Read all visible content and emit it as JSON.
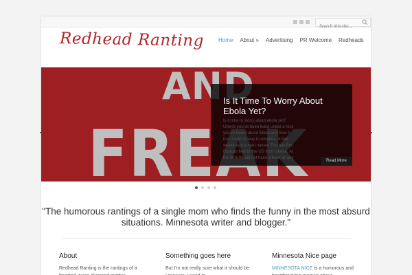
{
  "header": {
    "search_placeholder": "Search this site...",
    "logo_text": "Redhead Ranting",
    "nav": [
      "Home",
      "About »",
      "Advertising",
      "PR Welcome",
      "Redheads"
    ]
  },
  "hero": {
    "bg_word_1": "AND",
    "bg_word_2": "FREAK",
    "title": "Is It Time To Worry About Ebola Yet?",
    "excerpt": "Is it time to worry about ebola yet? Unless you've been living under a rock you've heard about Ebola and how it has made its way to America. A few weeks ago a man named Thomas Eric Duncan flew to the US from Liberia. At the time he did not have a fever or any",
    "read_more": "Read More",
    "slides": 4,
    "active_slide": 1
  },
  "tagline": "\"The humorous rantings of a single mom who finds the funny in the most absurd situations. Minnesota writer and blogger.\"",
  "widgets": [
    {
      "title": "About",
      "text": "Redhead Ranting is the rantings of a frazzled, twice divorced mother"
    },
    {
      "title": "Something goes here",
      "text": "But I'm not really sure what it should be. However, I need to"
    },
    {
      "title": "Minnesota Nice page",
      "link": "MINNESOTA NICE",
      "text": " is a humorous and heartbreaking memoir about"
    }
  ],
  "colors": {
    "accent": "#4a9fbf",
    "logo": "#b0262a",
    "hero_bg": "#9e1f22"
  }
}
